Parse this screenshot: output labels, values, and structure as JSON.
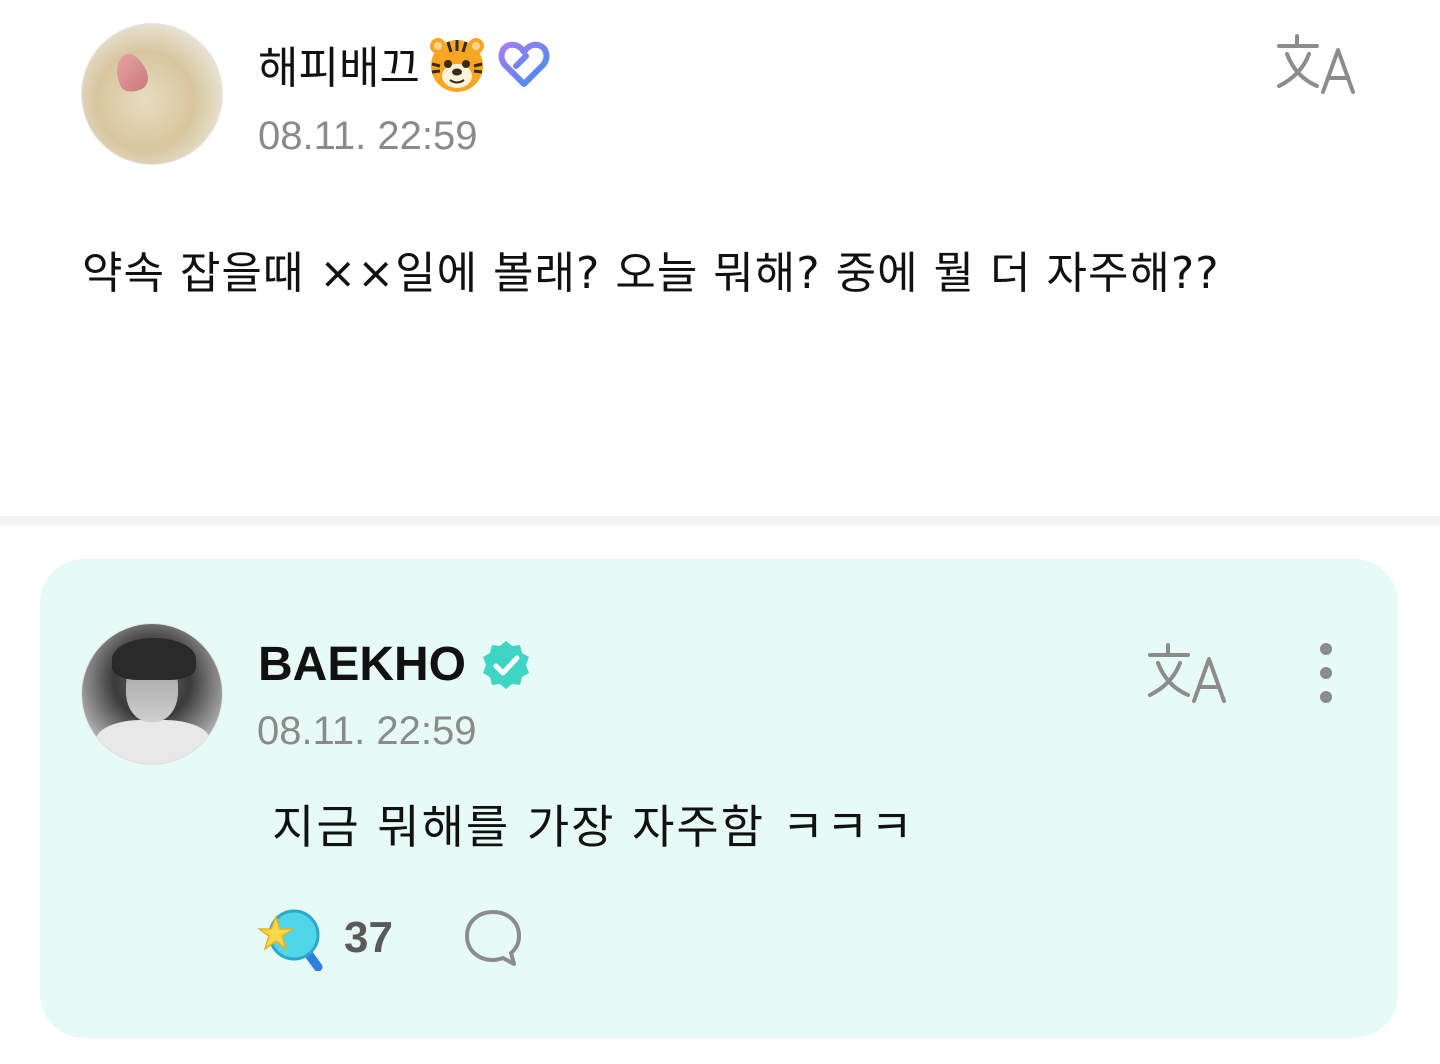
{
  "post": {
    "author": {
      "name": "해피배끄",
      "badges": [
        "tiger-emoji-icon",
        "heart-badge-icon"
      ]
    },
    "timestamp": "08.11. 22:59",
    "text": "약속 잡을때 ××일에 볼래? 오늘 뭐해? 중에 뭘 더 자주해??",
    "translate_icon": "translate-icon"
  },
  "reply": {
    "author": {
      "name": "BAEKHO",
      "badge": "verified-icon"
    },
    "timestamp": "08.11. 22:59",
    "text": "지금 뭐해를 가장 자주함 ㅋㅋㅋ",
    "reactions": {
      "icon": "star-wand-icon",
      "count": "37"
    },
    "comment_icon": "comment-bubble-icon",
    "more_icon": "more-vertical-icon"
  },
  "colors": {
    "reply_background": "#e6fbf5",
    "verified": "#3fd5c5",
    "timestamp": "#8a8a8a",
    "icon_gray": "#888888"
  }
}
